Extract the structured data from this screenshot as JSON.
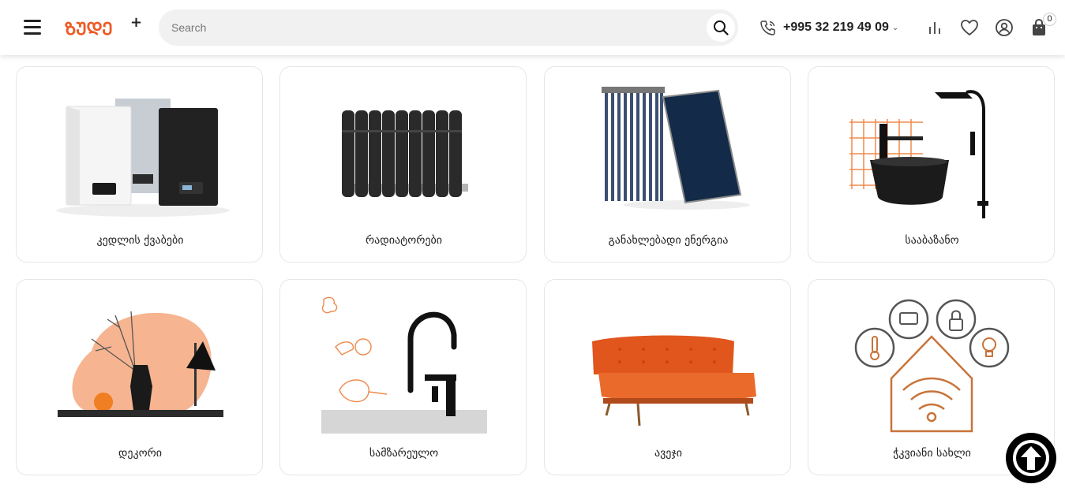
{
  "header": {
    "logo_text": "ᲖᲣᲓᲔ",
    "logo_plus": "+",
    "search_placeholder": "Search",
    "phone": "+995 32 219 49 09",
    "cart_count": "0"
  },
  "icons": {
    "menu": "hamburger-icon",
    "search": "search-icon",
    "phone": "phone-icon",
    "compare": "compare-icon",
    "wishlist": "heart-icon",
    "account": "user-icon",
    "cart": "cart-icon",
    "scroll_top": "arrow-up-icon"
  },
  "colors": {
    "accent": "#ee5a24",
    "text": "#222222",
    "border": "#e6e6e6"
  },
  "categories": [
    {
      "label": "კედლის ქვაბები"
    },
    {
      "label": "რადიატორები"
    },
    {
      "label": "განახლებადი ენერგია"
    },
    {
      "label": "სააბაზანო"
    },
    {
      "label": "დეკორი"
    },
    {
      "label": "სამზარეულო"
    },
    {
      "label": "ავეჯი"
    },
    {
      "label": "ჭკვიანი სახლი"
    }
  ]
}
